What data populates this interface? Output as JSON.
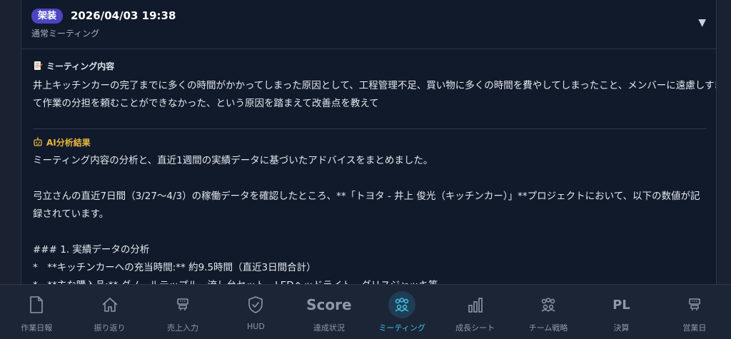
{
  "meeting": {
    "badge": "架装",
    "datetime": "2026/04/03 19:38",
    "type": "通常ミーティング",
    "toggle_icon": "▼"
  },
  "content_section": {
    "title": "ミーティング内容",
    "lines": [
      "井上キッチンカーの完了までに多くの時間がかかってしまった原因として、工程管理不足、買い物に多くの時間を費やしてしまったこと、メンバーに遠慮しすぎ",
      "て作業の分担を頼むことができなかった、という原因を踏まえて改善点を教えて"
    ]
  },
  "ai_section": {
    "title": "AI分析結果",
    "lines": [
      "ミーティング内容の分析と、直近1週間の実績データに基づいたアドバイスをまとめました。",
      "",
      "弓立さんの直近7日間（3/27〜4/3）の稼働データを確認したところ、**「トヨタ - 井上 俊光（キッチンカー）」**プロジェクトにおいて、以下の数値が記",
      "録されています。",
      "",
      "### 1. 実績データの分析",
      "*　**キッチンカーへの充当時間:** 約9.5時間（直近3日間合計）",
      "*　**主な購入品:** ダノールテップル　流し台セット　LEDヘッドライト　グリスジャッキ等"
    ]
  },
  "nav": [
    {
      "label": "作業日報",
      "icon": "document-icon"
    },
    {
      "label": "振り返り",
      "icon": "home-icon"
    },
    {
      "label": "売上入力",
      "icon": "register-icon"
    },
    {
      "label": "HUD",
      "icon": "shield-check-icon"
    },
    {
      "label": "達成状況",
      "icon": "score-icon",
      "text": "Score"
    },
    {
      "label": "ミーティング",
      "icon": "meeting-icon",
      "active": true
    },
    {
      "label": "成長シート",
      "icon": "bar-chart-icon"
    },
    {
      "label": "チーム戦略",
      "icon": "team-icon"
    },
    {
      "label": "決算",
      "icon": "pl-icon",
      "text": "PL"
    },
    {
      "label": "営業日",
      "icon": "register-icon"
    }
  ],
  "colors": {
    "accent": "#3fc3e6",
    "badge": "#4c44c4",
    "ai_title": "#e8b73d"
  }
}
